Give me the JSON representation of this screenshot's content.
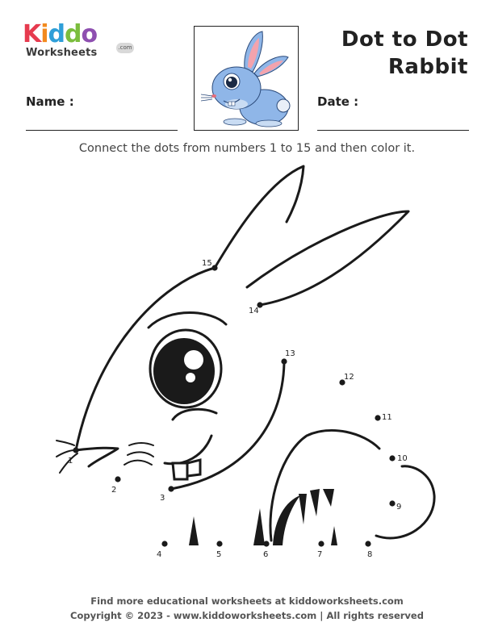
{
  "logo": {
    "letters": [
      {
        "char": "K",
        "color": "#e63b4f"
      },
      {
        "char": "i",
        "color": "#f28a1e"
      },
      {
        "char": "d",
        "color": "#2f9fd8"
      },
      {
        "char": "d",
        "color": "#7bbd3d"
      },
      {
        "char": "o",
        "color": "#8e4fb0"
      }
    ],
    "subtitle": "Worksheets",
    "suffix": ".com"
  },
  "title": {
    "line1": "Dot to Dot",
    "line2": "Rabbit"
  },
  "fields": {
    "name_label": "Name :",
    "date_label": "Date :"
  },
  "instructions": "Connect the dots from numbers 1 to 15 and then color it.",
  "dots": [
    {
      "label": "1"
    },
    {
      "label": "2"
    },
    {
      "label": "3"
    },
    {
      "label": "4"
    },
    {
      "label": "5"
    },
    {
      "label": "6"
    },
    {
      "label": "7"
    },
    {
      "label": "8"
    },
    {
      "label": "9"
    },
    {
      "label": "10"
    },
    {
      "label": "11"
    },
    {
      "label": "12"
    },
    {
      "label": "13"
    },
    {
      "label": "14"
    },
    {
      "label": "15"
    }
  ],
  "footer": {
    "line1": "Find more educational worksheets at kiddoworksheets.com",
    "line2": "Copyright © 2023 - www.kiddoworksheets.com  |  All rights reserved"
  },
  "colors": {
    "rabbit_blue": "#8fb6e8",
    "ear_pink": "#f3a3ad",
    "ink": "#1a1a1a"
  }
}
